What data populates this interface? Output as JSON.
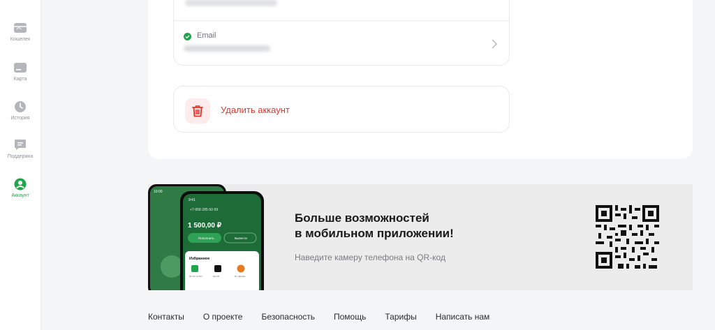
{
  "sidebar": {
    "items": [
      {
        "label": "Кошелек",
        "icon": "wallet-icon"
      },
      {
        "label": "Карта",
        "icon": "card-icon"
      },
      {
        "label": "История",
        "icon": "clock-icon"
      },
      {
        "label": "Поддержка",
        "icon": "chat-icon"
      },
      {
        "label": "Аккаунт",
        "icon": "user-icon",
        "active": true
      }
    ]
  },
  "contacts": {
    "email_label": "Email"
  },
  "delete_account": {
    "label": "Удалить аккаунт",
    "icon": "trash-icon"
  },
  "promo": {
    "title_line1": "Больше возможностей",
    "title_line2": "в мобильном приложении!",
    "subtitle": "Наведите камеру телефона на QR-код",
    "phone": {
      "status_time": "9:41",
      "back_time": "10:00",
      "account": "+7-958-285-50-59",
      "balance": "1 500,00 ₽",
      "btn_topup": "Пополнить",
      "btn_out": "Вывести",
      "favorites": "Избранное",
      "fav_items": [
        "За чёт ча Тип",
        "На СЭ",
        "Из тарелки"
      ]
    }
  },
  "footer": {
    "links": [
      "Контакты",
      "О проекте",
      "Безопасность",
      "Помощь",
      "Тарифы",
      "Написать нам"
    ]
  },
  "colors": {
    "accent_green": "#1fa64a",
    "danger_red": "#e2342b",
    "background": "#f4f5f6"
  }
}
